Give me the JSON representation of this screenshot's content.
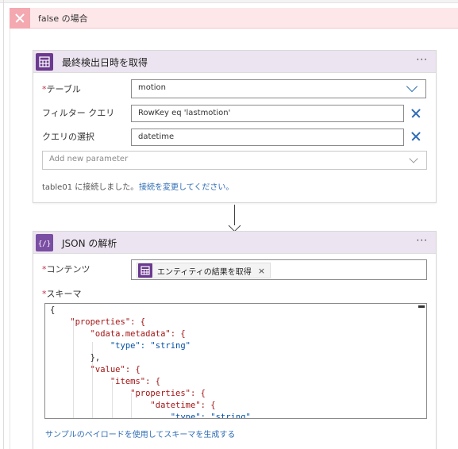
{
  "branch": {
    "title": "false の場合"
  },
  "card1": {
    "title": "最終検出日時を取得",
    "more": "···",
    "table_label": "テーブル",
    "table_required": "*",
    "table_value": "motion",
    "filter_label": "フィルター クエリ",
    "filter_value": "RowKey eq 'lastmotion'",
    "select_label": "クエリの選択",
    "select_value": "datetime",
    "add_param_placeholder": "Add new parameter",
    "connection_text": "table01 に接続しました。",
    "change_connection_link": "接続を変更してください。"
  },
  "card2": {
    "title": "JSON の解析",
    "more": "···",
    "content_label": "コンテンツ",
    "content_required": "*",
    "content_token": "エンティティの結果を取得",
    "token_close": "×",
    "schema_label": "スキーマ",
    "schema_required": "*",
    "schema_lines": [
      "{",
      "    \"properties\": {",
      "        \"odata.metadata\": {",
      "            \"type\": \"string\"",
      "        },",
      "        \"value\": {",
      "            \"items\": {",
      "                \"properties\": {",
      "                    \"datetime\": {",
      "                        \"type\": \"string\""
    ],
    "sample_payload_link": "サンプルのペイロードを使用してスキーマを生成する"
  },
  "colors": {
    "accent": "#2f6db5",
    "connector_purple": "#6b3a8f",
    "branch_bg": "#fde7e9",
    "card_header_bg": "#ece4f0"
  }
}
